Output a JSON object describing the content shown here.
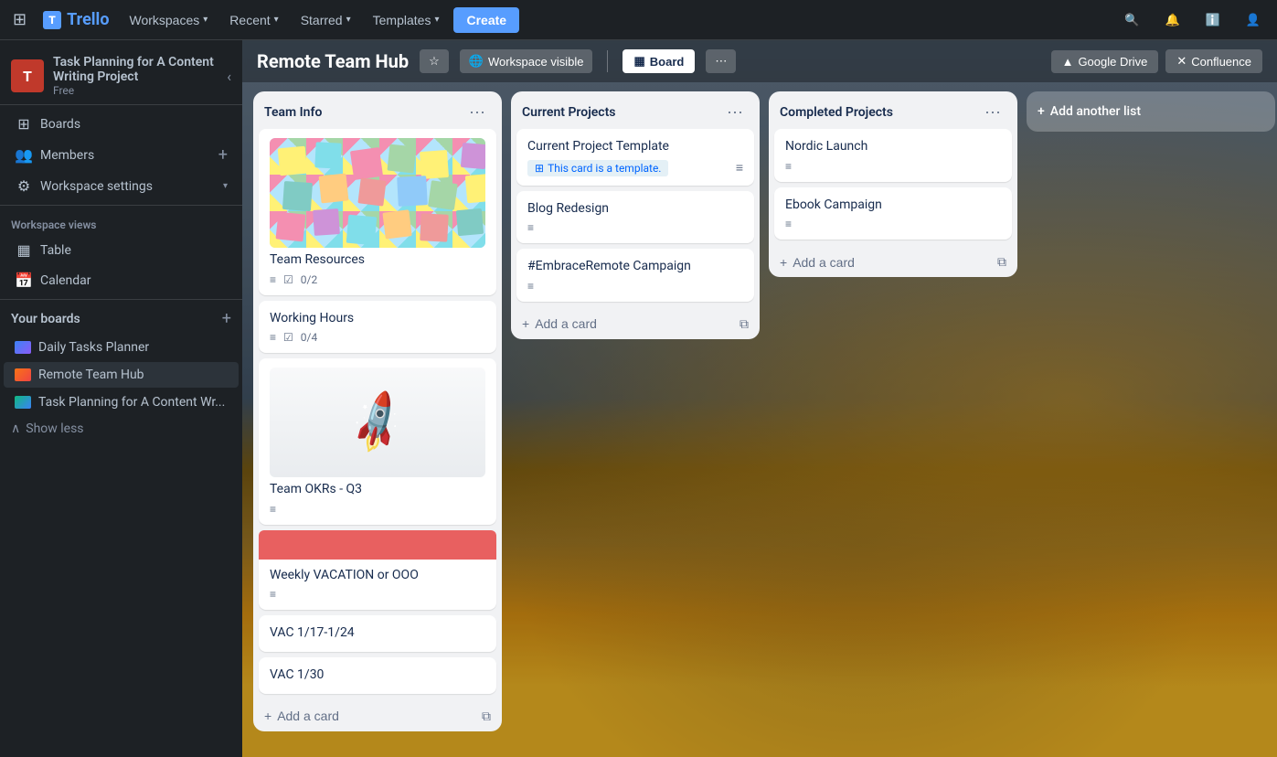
{
  "topnav": {
    "logo_text": "Trello",
    "workspaces_label": "Workspaces",
    "recent_label": "Recent",
    "starred_label": "Starred",
    "templates_label": "Templates",
    "create_label": "Create",
    "google_drive_label": "Google Drive",
    "confluence_label": "Confluence"
  },
  "sidebar": {
    "workspace_initial": "T",
    "workspace_name": "Task Planning for A Content Writing Project",
    "workspace_plan": "Free",
    "boards_label": "Boards",
    "members_label": "Members",
    "workspace_settings_label": "Workspace settings",
    "workspace_views_title": "Workspace views",
    "table_label": "Table",
    "calendar_label": "Calendar",
    "your_boards_title": "Your boards",
    "boards": [
      {
        "label": "Daily Tasks Planner",
        "type": "daily"
      },
      {
        "label": "Remote Team Hub",
        "type": "remote"
      },
      {
        "label": "Task Planning for A Content Wr...",
        "type": "task"
      }
    ],
    "show_less_label": "Show less"
  },
  "board_header": {
    "title": "Remote Team Hub",
    "visible_label": "Workspace visible",
    "board_label": "Board",
    "google_drive_label": "Google Drive",
    "confluence_label": "Confluence"
  },
  "lists": [
    {
      "id": "team-info",
      "title": "Team Info",
      "cards": [
        {
          "id": "team-resources",
          "title": "Team Resources",
          "has_cover": true,
          "cover_type": "sticky-notes",
          "desc_icon": true,
          "checklist": "0/2"
        },
        {
          "id": "working-hours",
          "title": "Working Hours",
          "desc_icon": true,
          "checklist": "0/4"
        },
        {
          "id": "team-okrs",
          "title": "Team OKRs - Q3",
          "has_cover": true,
          "cover_type": "rocket",
          "desc_icon": true
        },
        {
          "id": "weekly-vacation",
          "title": "Weekly VACATION or OOO",
          "has_cover": true,
          "cover_type": "red-bar",
          "desc_icon": true
        },
        {
          "id": "vac-1",
          "title": "VAC 1/17-1/24"
        },
        {
          "id": "vac-2",
          "title": "VAC 1/30"
        }
      ],
      "add_card_label": "Add a card"
    },
    {
      "id": "current-projects",
      "title": "Current Projects",
      "cards": [
        {
          "id": "current-project-template",
          "title": "Current Project Template",
          "is_template": true,
          "template_label": "This card is a template.",
          "desc_icon": true
        },
        {
          "id": "blog-redesign",
          "title": "Blog Redesign",
          "desc_icon": true
        },
        {
          "id": "embrace-remote",
          "title": "#EmbraceRemote Campaign",
          "desc_icon": true
        }
      ],
      "add_card_label": "Add a card"
    },
    {
      "id": "completed-projects",
      "title": "Completed Projects",
      "cards": [
        {
          "id": "nordic-launch",
          "title": "Nordic Launch",
          "desc_icon": true
        },
        {
          "id": "ebook-campaign",
          "title": "Ebook Campaign",
          "desc_icon": true
        }
      ],
      "add_card_label": "Add a card"
    }
  ],
  "add_list_label": "Add another list"
}
